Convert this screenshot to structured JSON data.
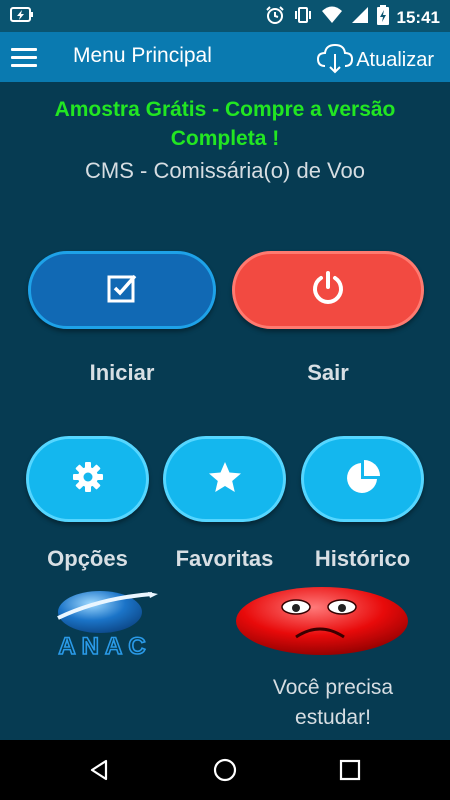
{
  "status_bar": {
    "time": "15:41",
    "icons": [
      "battery-charging-icon",
      "alarm-icon",
      "vibrate-icon",
      "wifi-icon",
      "signal-icon",
      "battery-icon"
    ]
  },
  "app_bar": {
    "title": "Menu Principal",
    "update_label": "Atualizar"
  },
  "promo": {
    "line1": "Amostra Grátis - Compre a versão",
    "line2": "Completa !"
  },
  "subtitle": "CMS - Comissária(o) de Voo",
  "buttons": {
    "start": "Iniciar",
    "exit": "Sair",
    "options": "Opções",
    "favorites": "Favoritas",
    "history": "Histórico"
  },
  "logo": {
    "text": "ANAC"
  },
  "status_message": {
    "line1": "Você precisa",
    "line2": "estudar!"
  },
  "colors": {
    "background": "#063b52",
    "app_bar": "#0a7ab0",
    "promo_green": "#22e622",
    "start_blue": "#1169b4",
    "exit_red": "#f24a41",
    "secondary_cyan": "#14b7ee"
  }
}
